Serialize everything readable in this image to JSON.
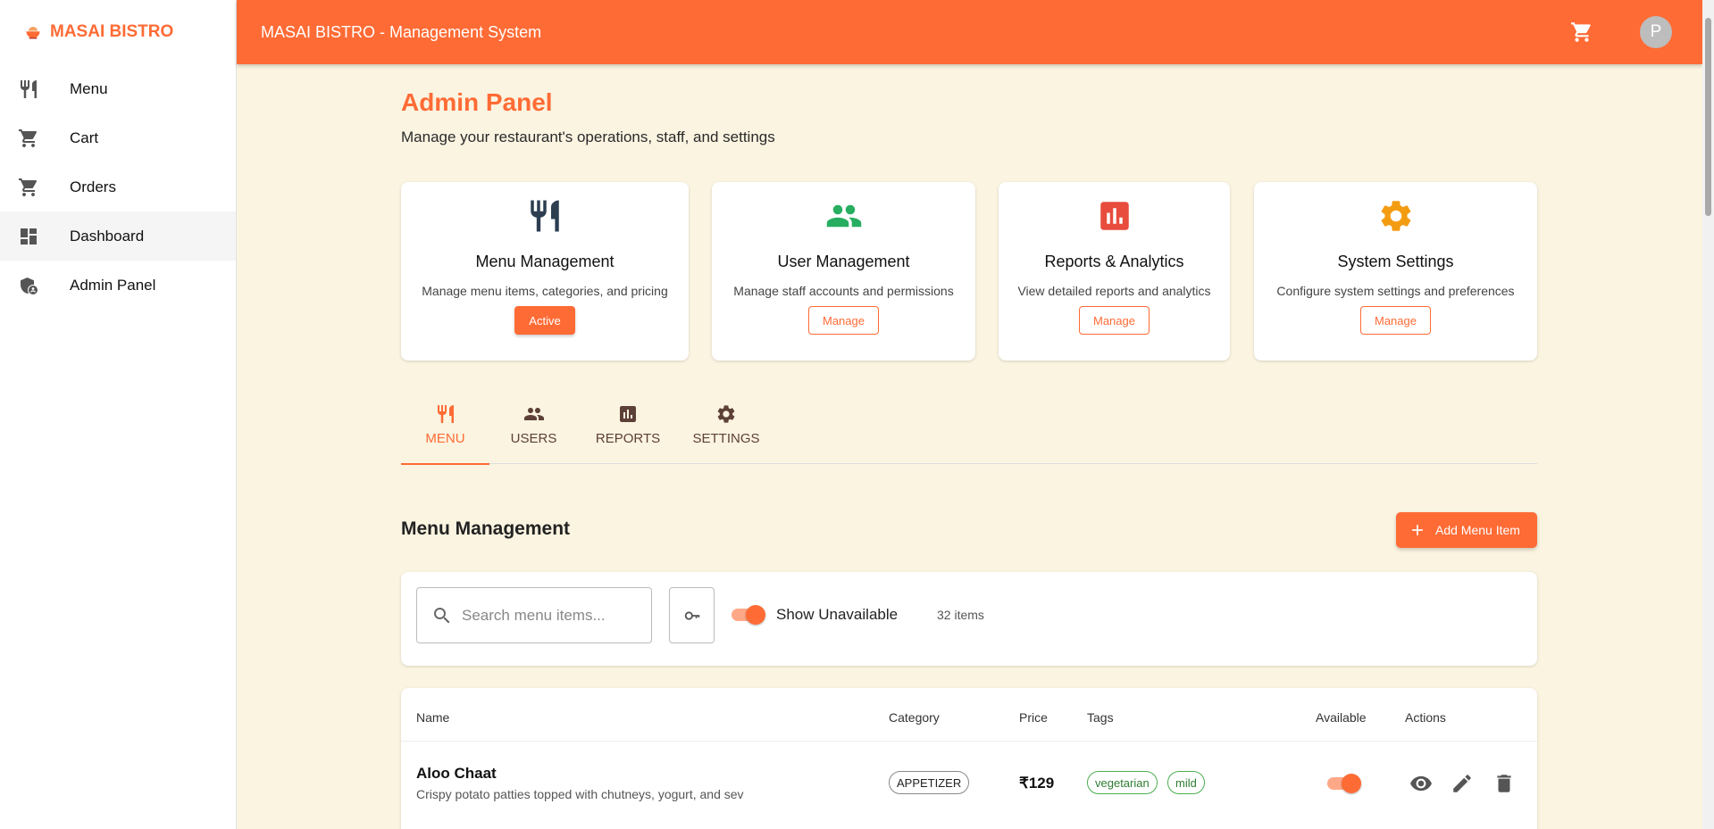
{
  "colors": {
    "accent": "#ff6b35",
    "background": "#fbf4e1",
    "menu_icon": "#2c3e50",
    "users_icon": "#27ae60",
    "reports_icon": "#e74c3c",
    "settings_icon": "#f39c12",
    "tag_green": "#4caf50"
  },
  "brand": {
    "name": "MASAI BISTRO",
    "logo_icon": "bowl-icon"
  },
  "sidebar": {
    "items": [
      {
        "label": "Menu",
        "icon": "restaurant-icon"
      },
      {
        "label": "Cart",
        "icon": "cart-icon"
      },
      {
        "label": "Orders",
        "icon": "cart-icon"
      },
      {
        "label": "Dashboard",
        "icon": "dashboard-icon"
      },
      {
        "label": "Admin Panel",
        "icon": "admin-shield-icon"
      }
    ]
  },
  "topbar": {
    "title": "MASAI BISTRO - Management System",
    "avatar_initial": "P"
  },
  "page": {
    "title": "Admin Panel",
    "subtitle": "Manage your restaurant's operations, staff, and settings"
  },
  "cards": [
    {
      "title": "Menu Management",
      "description": "Manage menu items, categories, and pricing",
      "button": "Active",
      "icon": "restaurant-icon"
    },
    {
      "title": "User Management",
      "description": "Manage staff accounts and permissions",
      "button": "Manage",
      "icon": "people-icon"
    },
    {
      "title": "Reports & Analytics",
      "description": "View detailed reports and analytics",
      "button": "Manage",
      "icon": "bar-chart-icon"
    },
    {
      "title": "System Settings",
      "description": "Configure system settings and preferences",
      "button": "Manage",
      "icon": "gear-icon"
    }
  ],
  "tabs": [
    {
      "label": "MENU",
      "icon": "restaurant-icon"
    },
    {
      "label": "USERS",
      "icon": "people-icon"
    },
    {
      "label": "REPORTS",
      "icon": "bar-chart-icon"
    },
    {
      "label": "SETTINGS",
      "icon": "gear-icon"
    }
  ],
  "menu_section": {
    "title": "Menu Management",
    "add_button": "Add Menu Item",
    "search_placeholder": "Search menu items...",
    "toggle_label": "Show Unavailable",
    "show_unavailable": true,
    "item_count": "32 items"
  },
  "table": {
    "headers": [
      "Name",
      "Category",
      "Price",
      "Tags",
      "Available",
      "Actions"
    ],
    "rows": [
      {
        "name": "Aloo Chaat",
        "description": "Crispy potato patties topped with chutneys, yogurt, and sev",
        "category": "APPETIZER",
        "price": "₹129",
        "tags": [
          "vegetarian",
          "mild"
        ],
        "available": true
      }
    ]
  }
}
